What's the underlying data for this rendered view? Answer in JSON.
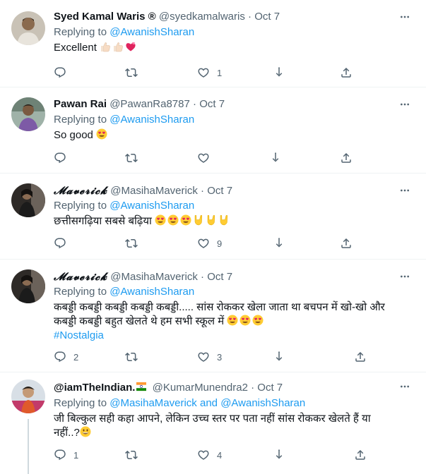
{
  "tweets": [
    {
      "name": "Syed Kamal Waris ®",
      "handle": "@syedkamalwaris",
      "dot": "·",
      "time": "Oct 7",
      "replying_prefix": "Replying to ",
      "replying_to": "@AwanishSharan",
      "text": "Excellent",
      "emojis": [
        "thumbs-up-icon",
        "thumbs-up-icon",
        "heart-ribbon-icon"
      ],
      "reply_count": "",
      "retweet_count": "",
      "like_count": "1"
    },
    {
      "name": "Pawan Rai",
      "handle": "@PawanRa8787",
      "dot": "·",
      "time": "Oct 7",
      "replying_prefix": "Replying to ",
      "replying_to": "@AwanishSharan",
      "text": "So good",
      "emojis": [
        "heart-eyes-icon"
      ],
      "reply_count": "",
      "retweet_count": "",
      "like_count": ""
    },
    {
      "name": "𝓜𝓪𝓿𝓮𝓻𝓲𝓬𝓴",
      "handle": "@MasihaMaverick",
      "dot": "·",
      "time": "Oct 7",
      "replying_prefix": "Replying to ",
      "replying_to": "@AwanishSharan",
      "text": "छत्तीसगढ़िया सबसे बढ़िया",
      "emojis": [
        "heart-eyes-icon",
        "heart-eyes-icon",
        "heart-eyes-icon",
        "rock-hand-icon",
        "rock-hand-icon",
        "rock-hand-icon"
      ],
      "reply_count": "",
      "retweet_count": "",
      "like_count": "9"
    },
    {
      "name": "𝓜𝓪𝓿𝓮𝓻𝓲𝓬𝓴",
      "handle": "@MasihaMaverick",
      "dot": "·",
      "time": "Oct 7",
      "replying_prefix": "Replying to ",
      "replying_to": "@AwanishSharan",
      "text_line1": "कबड्डी कबड्डी कबड्डी कबड्डी कबड्डी..... सांस रोककर खेला जाता था बचपन में खो-खो और",
      "text_line2": "कबड्डी कबड्डी बहुत खेलते थे हम सभी स्कूल में",
      "emojis": [
        "heart-eyes-icon",
        "heart-eyes-icon",
        "heart-eyes-icon"
      ],
      "hashtag": "#Nostalgia",
      "reply_count": "2",
      "retweet_count": "",
      "like_count": "3"
    },
    {
      "name": "@iamTheIndian.",
      "flag": "india-flag-icon",
      "handle": "@KumarMunendra2",
      "dot": "·",
      "time": "Oct 7",
      "replying_prefix": "Replying to ",
      "replying_to": "@MasihaMaverick",
      "replying_and": " and ",
      "replying_to2": "@AwanishSharan",
      "text_line1": "जी बिल्कुल सही कहा आपने, लेकिन उच्च स्तर पर पता नहीं सांस रोककर खेलते हैं या",
      "text_line2": "नहीं..?",
      "emojis": [
        "grinning-face-icon"
      ],
      "reply_count": "1",
      "retweet_count": "",
      "like_count": "4"
    }
  ],
  "colors": {
    "link": "#1d9bf0",
    "secondary": "#536471",
    "border": "#eff3f4",
    "thread_line": "#cfd9de"
  }
}
